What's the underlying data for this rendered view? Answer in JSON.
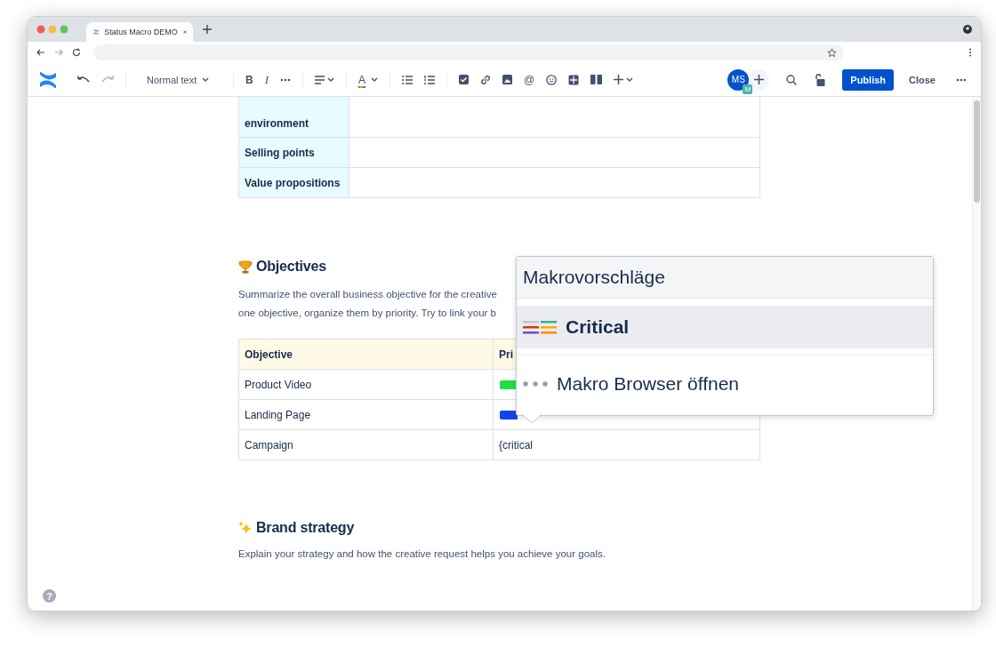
{
  "browser": {
    "tab_title": "Status Macro DEMO"
  },
  "toolbar": {
    "text_style": "Normal text",
    "bold": "B",
    "italic": "I",
    "text_color": "A",
    "mention": "@",
    "avatar": "MS",
    "avatar_badge": "M",
    "publish": "Publish",
    "close": "Close"
  },
  "top_table": {
    "rows": [
      {
        "label": "environment",
        "value": ""
      },
      {
        "label": "Selling points",
        "value": ""
      },
      {
        "label": "Value propositions",
        "value": ""
      }
    ]
  },
  "objectives": {
    "heading": "Objectives",
    "lines": [
      "Summarize the overall business objective for the creative",
      "one objective, organize them by priority. Try to link your b"
    ],
    "columns": [
      "Objective",
      "Pri"
    ],
    "rows": [
      {
        "objective": "Product Video",
        "color": "#22dd44"
      },
      {
        "objective": "Landing Page",
        "color": "#1144ee"
      },
      {
        "objective": "Campaign",
        "text": "{critical"
      }
    ]
  },
  "macro_popup": {
    "title": "Makrovorschläge",
    "items": [
      {
        "kind": "macro",
        "label": "Critical",
        "selected": true
      },
      {
        "kind": "browser",
        "label": "Makro Browser öffnen",
        "selected": false
      }
    ]
  },
  "brand": {
    "heading": "Brand strategy",
    "text": "Explain your strategy and how the creative request helps you achieve your goals."
  },
  "help": "?"
}
